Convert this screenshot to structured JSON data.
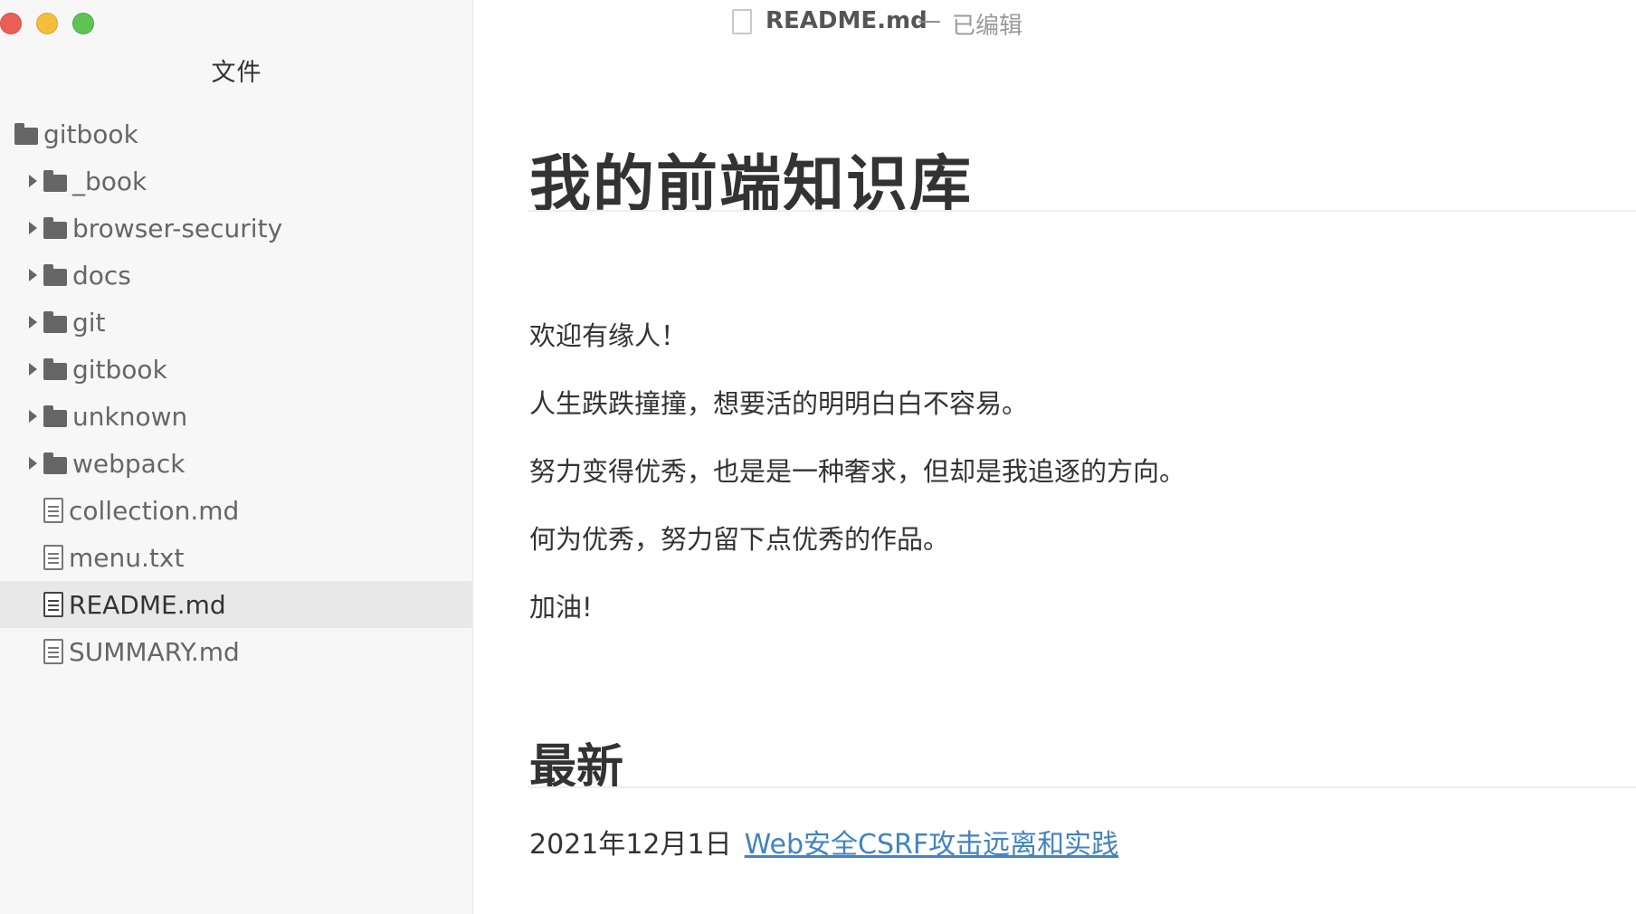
{
  "sidebar": {
    "title": "文件",
    "root": {
      "label": "gitbook"
    },
    "folders": [
      {
        "label": "_book"
      },
      {
        "label": "browser-security"
      },
      {
        "label": "docs"
      },
      {
        "label": "git"
      },
      {
        "label": "gitbook"
      },
      {
        "label": "unknown"
      },
      {
        "label": "webpack"
      }
    ],
    "files": [
      {
        "label": "collection.md"
      },
      {
        "label": "menu.txt"
      },
      {
        "label": "README.md",
        "selected": true
      },
      {
        "label": "SUMMARY.md"
      }
    ]
  },
  "titlebar": {
    "filename": "README.md",
    "separator": "—",
    "status": "已编辑"
  },
  "document": {
    "heading": "我的前端知识库",
    "paragraphs": [
      "欢迎有缘人！",
      "人生跌跌撞撞，想要活的明明白白不容易。",
      "努力变得优秀，也是是一种奢求，但却是我追逐的方向。",
      "何为优秀，努力留下点优秀的作品。",
      "加油!"
    ],
    "section_heading": "最新",
    "latest": {
      "date": "2021年12月1日",
      "link_text": "Web安全CSRF攻击远离和实践"
    }
  },
  "colors": {
    "link": "#4183c4",
    "sidebar_bg": "#f7f7f7",
    "selected_row": "#e8e8e8"
  }
}
